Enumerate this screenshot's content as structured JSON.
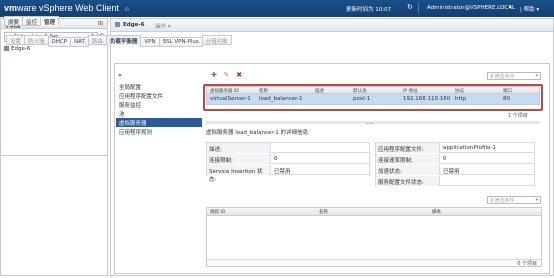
{
  "header": {
    "brand_vm": "vm",
    "brand_ware": "ware",
    "brand_rest": "vSphere Web Client",
    "home_icon": "home-icon",
    "updated": "更新时间为 10:07",
    "refresh_icon": "refresh-icon",
    "user": "Administrator@VSPHERE.LOCAL",
    "user_caret": "▾",
    "help": "| 帮助 ▾"
  },
  "nav": {
    "title": "导航器",
    "pin_icon": "pin-icon",
    "path": "Networking & Sec...",
    "back": "◂",
    "path_count": "1",
    "history_icon": "history-icon",
    "items": [
      {
        "label": "Edge-6",
        "icon": "edge-icon"
      }
    ]
  },
  "object": {
    "name": "Edge-6",
    "actions": "操作 ▾"
  },
  "tabs_primary": [
    {
      "label": "摘要",
      "active": false
    },
    {
      "label": "监控",
      "active": false
    },
    {
      "label": "管理",
      "active": true
    }
  ],
  "tabs_secondary": [
    {
      "label": "设置",
      "gray": true
    },
    {
      "label": "防火墙",
      "gray": true
    },
    {
      "label": "DHCP",
      "gray": false
    },
    {
      "label": "NAT",
      "gray": false
    },
    {
      "label": "路由",
      "gray": true
    },
    {
      "label": "负载平衡器",
      "gray": false,
      "active": true
    },
    {
      "label": "VPN",
      "gray": false
    },
    {
      "label": "SSL VPN-Plus",
      "gray": false
    },
    {
      "label": "分组对象",
      "gray": true
    }
  ],
  "left_menu": {
    "collapse": "«",
    "items": [
      {
        "label": "全局配置",
        "selected": false
      },
      {
        "label": "应用程序配置文件",
        "selected": false
      },
      {
        "label": "服务监控",
        "selected": false
      },
      {
        "label": "池",
        "selected": false
      },
      {
        "label": "虚拟服务器",
        "selected": true
      },
      {
        "label": "应用程序规则",
        "selected": false
      }
    ]
  },
  "toolbar": {
    "add": "✚",
    "edit": "✎",
    "delete": "✖"
  },
  "filter": {
    "placeholder": "筛选条件",
    "icon": "filter-icon",
    "caret": "▾"
  },
  "vs_table": {
    "columns": [
      "虚拟服务器 ID",
      "名称",
      "描述",
      "默认池",
      "IP 地址",
      "协议",
      "端口"
    ],
    "rows": [
      [
        "virtualServer-1",
        "load_balancer-1",
        "",
        "pool-1",
        "192.168.110.160",
        "http",
        "80"
      ]
    ],
    "count": "1 个项目"
  },
  "detail": {
    "title": "虚拟服务器 load_balancer-1 的详细信息:",
    "left": [
      {
        "key": "描述:",
        "value": ""
      },
      {
        "key": "连接限制:",
        "value": "0"
      },
      {
        "key": "Service Insertion 状态:",
        "value": "已禁用"
      }
    ],
    "right": [
      {
        "key": "应用程序配置文件:",
        "value": "applicationProfile-1"
      },
      {
        "key": "连接速率限制:",
        "value": "0"
      },
      {
        "key": "加速状态:",
        "value": "已禁用"
      },
      {
        "key": "服务配置文件状态:",
        "value": ""
      }
    ]
  },
  "rules_filter": {
    "placeholder": "筛选条件",
    "icon": "filter-icon",
    "caret": "▾"
  },
  "rules_table": {
    "columns": [
      "规则 ID",
      "名称",
      "脚本"
    ],
    "count": "0 个项目"
  }
}
